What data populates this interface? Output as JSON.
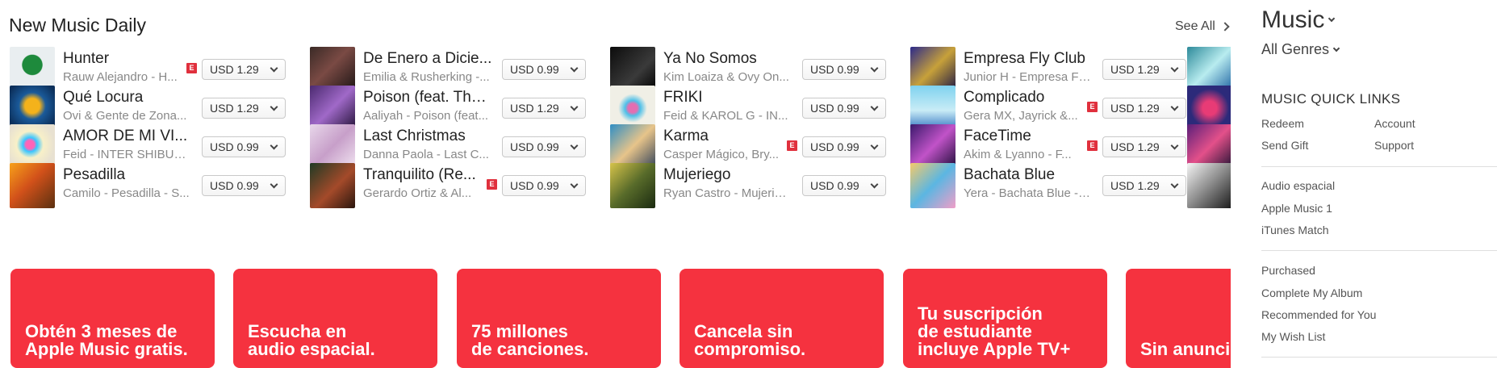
{
  "section": {
    "title": "New Music Daily",
    "see_all": "See All"
  },
  "songs": [
    [
      {
        "title": "Hunter",
        "artist": "Rauw Alejandro - H...",
        "explicit": true,
        "price": "USD 1.29"
      },
      {
        "title": "Qué Locura",
        "artist": "Ovi & Gente de Zona...",
        "explicit": false,
        "price": "USD 1.29"
      },
      {
        "title": "AMOR DE MI VI...",
        "artist": "Feid - INTER SHIBUY...",
        "explicit": false,
        "price": "USD 0.99"
      },
      {
        "title": "Pesadilla",
        "artist": "Camilo - Pesadilla - S...",
        "explicit": false,
        "price": "USD 0.99"
      }
    ],
    [
      {
        "title": "De Enero a Dicie...",
        "artist": "Emilia & Rusherking -...",
        "explicit": false,
        "price": "USD 0.99"
      },
      {
        "title": "Poison (feat. The...",
        "artist": "Aaliyah - Poison (feat...",
        "explicit": false,
        "price": "USD 1.29"
      },
      {
        "title": "Last Christmas",
        "artist": "Danna Paola - Last C...",
        "explicit": false,
        "price": "USD 0.99"
      },
      {
        "title": "Tranquilito (Re...",
        "artist": "Gerardo Ortiz & Al...",
        "explicit": true,
        "price": "USD 0.99"
      }
    ],
    [
      {
        "title": "Ya No Somos",
        "artist": "Kim Loaiza & Ovy On...",
        "explicit": false,
        "price": "USD 0.99"
      },
      {
        "title": "FRIKI",
        "artist": "Feid & KAROL G - IN...",
        "explicit": false,
        "price": "USD 0.99"
      },
      {
        "title": "Karma",
        "artist": "Casper Mágico, Bry...",
        "explicit": true,
        "price": "USD 0.99"
      },
      {
        "title": "Mujeriego",
        "artist": "Ryan Castro - Mujerie...",
        "explicit": false,
        "price": "USD 0.99"
      }
    ],
    [
      {
        "title": "Empresa Fly Club",
        "artist": "Junior H - Empresa Fl...",
        "explicit": false,
        "price": "USD 1.29"
      },
      {
        "title": "Complicado",
        "artist": "Gera MX, Jayrick &...",
        "explicit": true,
        "price": "USD 1.29"
      },
      {
        "title": "FaceTime",
        "artist": "Akim & Lyanno - F...",
        "explicit": true,
        "price": "USD 1.29"
      },
      {
        "title": "Bachata Blue",
        "artist": "Yera - Bachata Blue - ...",
        "explicit": false,
        "price": "USD 1.29"
      }
    ]
  ],
  "explicit_badge": "E",
  "promos": [
    "Obtén 3 meses de\nApple Music gratis.",
    "Escucha en\naudio espacial.",
    "75 millones\nde canciones.",
    "Cancela sin\ncompromiso.",
    "Tu suscripción\nde estudiante\nincluye Apple TV+",
    "Sin anuncios"
  ],
  "sidebar": {
    "music_label": "Music",
    "genres_label": "All Genres",
    "quick_links_heading": "MUSIC QUICK LINKS",
    "quick_links": [
      "Redeem",
      "Account",
      "Send Gift",
      "Support"
    ],
    "group1": [
      "Audio espacial",
      "Apple Music 1",
      "iTunes Match"
    ],
    "group2": [
      "Purchased",
      "Complete My Album",
      "Recommended for You",
      "My Wish List"
    ]
  },
  "colors": {
    "promo_red": "#f5323f",
    "explicit_red": "#e0303d"
  }
}
